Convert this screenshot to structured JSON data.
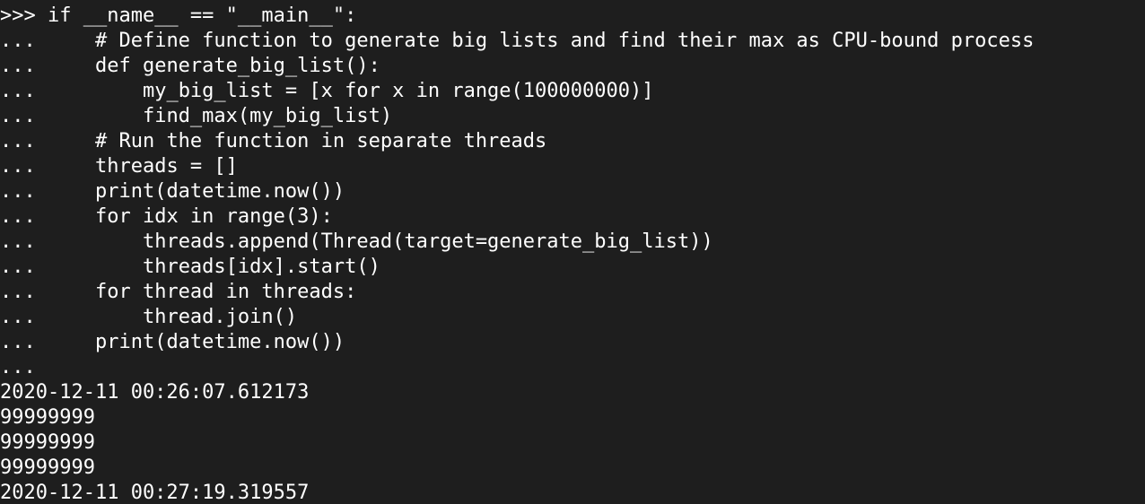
{
  "terminal": {
    "background": "#1e1e1e",
    "foreground": "#ffffff",
    "lines": [
      {
        "prompt": ">>> ",
        "code": "if __name__ == \"__main__\":"
      },
      {
        "prompt": "...     ",
        "code": "# Define function to generate big lists and find their max as CPU-bound process"
      },
      {
        "prompt": "...     ",
        "code": "def generate_big_list():"
      },
      {
        "prompt": "...         ",
        "code": "my_big_list = [x for x in range(100000000)]"
      },
      {
        "prompt": "...         ",
        "code": "find_max(my_big_list)"
      },
      {
        "prompt": "...     ",
        "code": "# Run the function in separate threads"
      },
      {
        "prompt": "...     ",
        "code": "threads = []"
      },
      {
        "prompt": "...     ",
        "code": "print(datetime.now())"
      },
      {
        "prompt": "...     ",
        "code": "for idx in range(3):"
      },
      {
        "prompt": "...         ",
        "code": "threads.append(Thread(target=generate_big_list))"
      },
      {
        "prompt": "...         ",
        "code": "threads[idx].start()"
      },
      {
        "prompt": "...     ",
        "code": "for thread in threads:"
      },
      {
        "prompt": "...         ",
        "code": "thread.join()"
      },
      {
        "prompt": "...     ",
        "code": "print(datetime.now())"
      },
      {
        "prompt": "...",
        "code": ""
      }
    ],
    "output": [
      "2020-12-11 00:26:07.612173",
      "99999999",
      "99999999",
      "99999999",
      "2020-12-11 00:27:19.319557"
    ]
  }
}
